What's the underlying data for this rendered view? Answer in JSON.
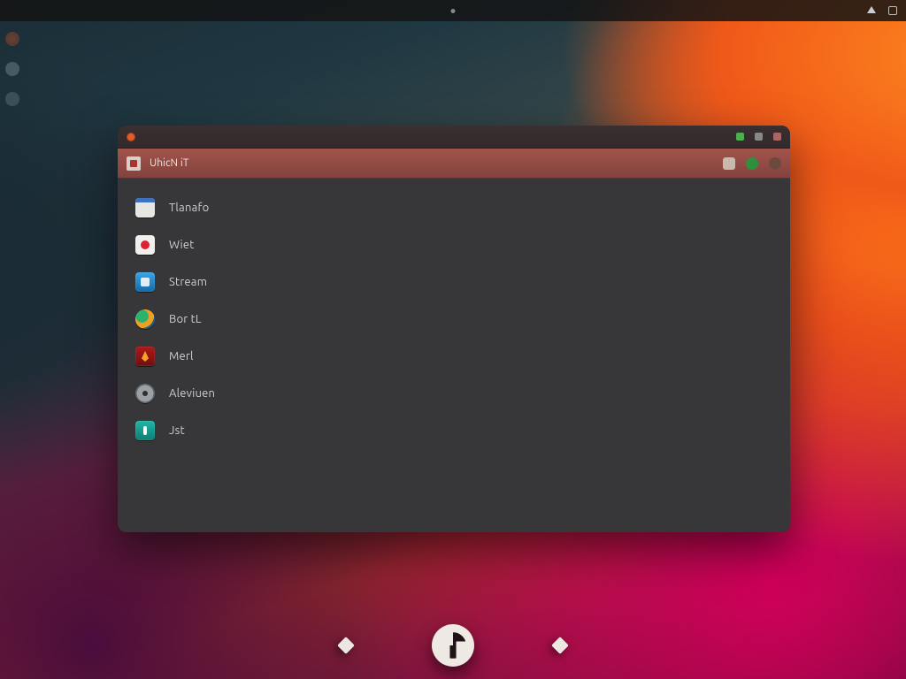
{
  "topbar": {
    "tray": {
      "sound_icon": "sound-icon",
      "network_icon": "network-icon"
    }
  },
  "window": {
    "titlebar": {
      "label": ""
    },
    "header": {
      "title": "UhicN iT",
      "right_icons": [
        "bookmark-icon",
        "status-indicator-icon",
        "refresh-icon"
      ]
    },
    "apps": [
      {
        "icon": "calendar-icon",
        "label": "Tlanafo"
      },
      {
        "icon": "camera-icon",
        "label": "Wiet"
      },
      {
        "icon": "cube-icon",
        "label": "Stream"
      },
      {
        "icon": "swirl-icon",
        "label": "Bor tL"
      },
      {
        "icon": "flame-icon",
        "label": "Merl"
      },
      {
        "icon": "gear-icon",
        "label": "Aleviuen"
      },
      {
        "icon": "teal-icon",
        "label": "Jst"
      }
    ]
  },
  "dock": {
    "left_indicator": "diamond-indicator",
    "center_logo": "os-logo",
    "right_indicator": "diamond-indicator"
  }
}
